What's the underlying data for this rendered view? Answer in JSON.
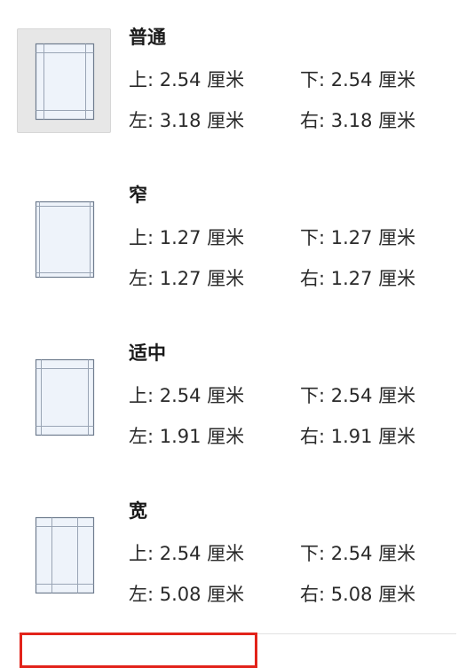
{
  "margins": [
    {
      "name": "普通",
      "selected": true,
      "top": "上: 2.54 厘米",
      "bottom": "下: 2.54 厘米",
      "left": "左: 3.18 厘米",
      "right": "右: 3.18 厘米"
    },
    {
      "name": "窄",
      "selected": false,
      "top": "上: 1.27 厘米",
      "bottom": "下: 1.27 厘米",
      "left": "左: 1.27 厘米",
      "right": "右: 1.27 厘米"
    },
    {
      "name": "适中",
      "selected": false,
      "top": "上: 2.54 厘米",
      "bottom": "下: 2.54 厘米",
      "left": "左: 1.91 厘米",
      "right": "右: 1.91 厘米"
    },
    {
      "name": "宽",
      "selected": false,
      "top": "上: 2.54 厘米",
      "bottom": "下: 2.54 厘米",
      "left": "左: 5.08 厘米",
      "right": "右: 5.08 厘米"
    }
  ],
  "colors": {
    "highlight": "#e2231a",
    "selected_bg": "#e7e7e7",
    "page_fill": "#eef3fa",
    "page_border": "#6f7c8e",
    "guide_line": "#9aa5b5"
  }
}
